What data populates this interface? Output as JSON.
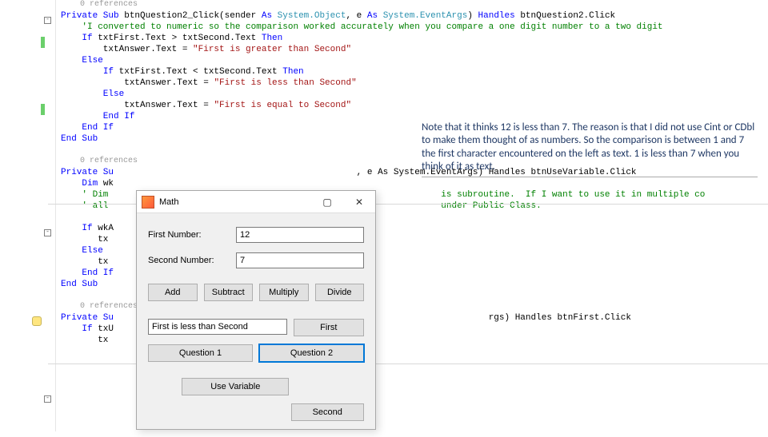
{
  "code": {
    "refcount_label": "0 references",
    "sub1": {
      "sig_prefix": "Private Sub",
      "sig_name": " btnQuestion2_Click(sender ",
      "sig_as1": "As",
      "sig_t1": " System.Object",
      "sig_mid": ", e ",
      "sig_as2": "As",
      "sig_t2": " System.EventArgs",
      "sig_tail1": ") ",
      "sig_handles": "Handles",
      "sig_tail2": " btnQuestion2.Click",
      "c1": "    'I converted to numeric so the comparison worked accurately when you compare a one digit number to a two digit",
      "l1a": "    ",
      "l1b": "If",
      "l1c": " txtFirst.Text > txtSecond.Text ",
      "l1d": "Then",
      "l2a": "        txtAnswer.Text = ",
      "l2b": "\"First is greater than Second\"",
      "l3": "    Else",
      "l4a": "        ",
      "l4b": "If",
      "l4c": " txtFirst.Text < txtSecond.Text ",
      "l4d": "Then",
      "l5a": "            txtAnswer.Text = ",
      "l5b": "\"First is less than Second\"",
      "l6": "        Else",
      "l7a": "            txtAnswer.Text = ",
      "l7b": "\"First is equal to Second\"",
      "l8": "        End If",
      "l9": "    End If",
      "l10": "End Sub"
    },
    "sub2": {
      "sig_prefix": "Private Su",
      "sig_tail": ", e As System.EventArgs) Handles btnUseVariable.Click",
      "l1": "    Dim wk",
      "c1": "    ' Dim ",
      "c1b": "is subroutine.  If I want to use it in multiple co",
      "c2": "    ' all ",
      "c2b": "under Public Class.",
      "l2a": "    If",
      "l2b": " wkA",
      "l3": "       tx",
      "l4": "    Else",
      "l5": "       tx",
      "l6": "    End If",
      "l7": "End Sub"
    },
    "sub3": {
      "sig_prefix": "Private Su",
      "sig_tail": "rgs) Handles btnFirst.Click",
      "l1a": "    If",
      "l1b": " txU",
      "l2": "       tx"
    }
  },
  "annotation": {
    "text": "Note that it thinks 12 is less than 7. The reason is that I did not use Cint or CDbl to make them thought of as numbers.  So the comparison is between 1 and 7 the first character encountered on the left as text. 1 is less than 7 when you think of it as text."
  },
  "form": {
    "title": "Math",
    "label_first": "First Number:",
    "label_second": "Second Number:",
    "value_first": "12",
    "value_second": "7",
    "btn_add": "Add",
    "btn_subtract": "Subtract",
    "btn_multiply": "Multiply",
    "btn_divide": "Divide",
    "answer_text": "First is less than Second",
    "btn_first": "First",
    "btn_q1": "Question 1",
    "btn_q2": "Question 2",
    "btn_usevar": "Use Variable",
    "btn_second": "Second"
  },
  "icons": {
    "maximize": "▢",
    "close": "✕"
  }
}
